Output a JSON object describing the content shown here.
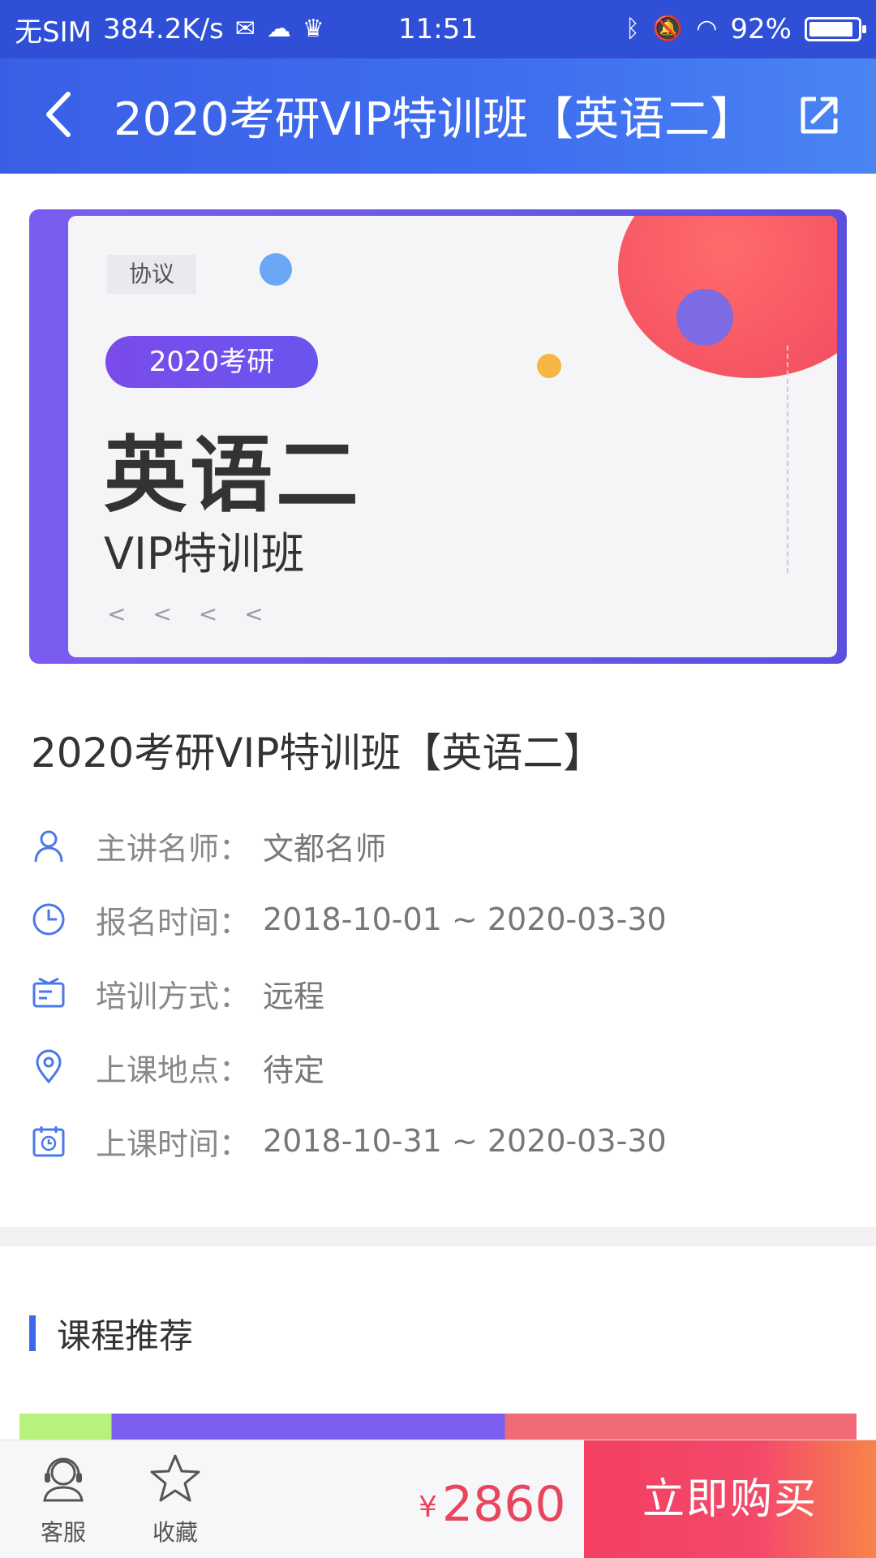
{
  "status_bar": {
    "carrier": "无SIM",
    "speed": "384.2K/s",
    "time": "11:51",
    "battery": "92%",
    "battery_level": 0.92
  },
  "header": {
    "title": "2020考研VIP特训班【英语二】"
  },
  "banner": {
    "tag": "协议",
    "pill": "2020考研",
    "headline": "英语二",
    "subline": "VIP特训班",
    "decor_chevrons": "< < < <"
  },
  "course": {
    "title": "2020考研VIP特训班【英语二】",
    "info": [
      {
        "icon": "teacher-icon",
        "label": "主讲名师：",
        "value": "文都名师"
      },
      {
        "icon": "clock-icon",
        "label": "报名时间：",
        "value": "2018-10-01 ~ 2020-03-30"
      },
      {
        "icon": "training-mode-icon",
        "label": "培训方式：",
        "value": "远程"
      },
      {
        "icon": "location-icon",
        "label": "上课地点：",
        "value": "待定"
      },
      {
        "icon": "calendar-icon",
        "label": "上课时间：",
        "value": "2018-10-31 ~ 2020-03-30"
      }
    ]
  },
  "recommend": {
    "heading": "课程推荐"
  },
  "bottom_bar": {
    "service_label": "客服",
    "favorite_label": "收藏",
    "currency": "¥",
    "price": "2860",
    "buy_label": "立即购买"
  },
  "colors": {
    "primary": "#3a5fe6",
    "accent_red": "#e8455f",
    "buy_start": "#f43f62",
    "buy_end": "#f7844a"
  }
}
